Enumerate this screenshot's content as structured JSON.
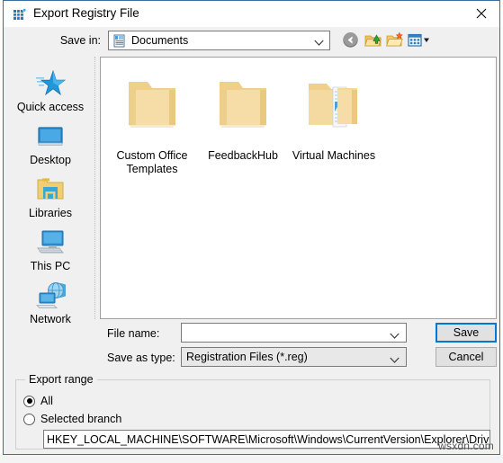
{
  "window": {
    "title": "Export Registry File",
    "icon": "registry-editor-icon",
    "close_label": "✕"
  },
  "toolbar": {
    "save_in_label": "Save in:",
    "current_folder": "Documents",
    "folder_icon": "documents-icon",
    "buttons": [
      {
        "name": "back-button",
        "icon": "back-arrow-icon"
      },
      {
        "name": "up-one-level-button",
        "icon": "up-folder-icon"
      },
      {
        "name": "new-folder-button",
        "icon": "new-folder-icon"
      },
      {
        "name": "views-button",
        "icon": "views-grid-icon"
      }
    ]
  },
  "places_bar": {
    "items": [
      {
        "label": "Quick access",
        "icon": "quick-access-star-icon"
      },
      {
        "label": "Desktop",
        "icon": "desktop-monitor-icon"
      },
      {
        "label": "Libraries",
        "icon": "libraries-folder-icon"
      },
      {
        "label": "This PC",
        "icon": "this-pc-icon"
      },
      {
        "label": "Network",
        "icon": "network-globe-icon"
      }
    ]
  },
  "file_list": {
    "items": [
      {
        "name": "Custom Office Templates",
        "icon": "folder-icon"
      },
      {
        "name": "FeedbackHub",
        "icon": "folder-icon"
      },
      {
        "name": "Virtual Machines",
        "icon": "folder-with-documents-icon"
      }
    ]
  },
  "form": {
    "file_name_label": "File name:",
    "file_name_value": "",
    "save_as_type_label": "Save as type:",
    "save_as_type_value": "Registration Files (*.reg)"
  },
  "buttons": {
    "save_label": "Save",
    "cancel_label": "Cancel",
    "focus_color": "#0078d7"
  },
  "export_range": {
    "legend": "Export range",
    "options": [
      {
        "label": "All",
        "selected": true
      },
      {
        "label": "Selected branch",
        "selected": false
      }
    ],
    "branch_path": "HKEY_LOCAL_MACHINE\\SOFTWARE\\Microsoft\\Windows\\CurrentVersion\\Explorer\\DriveIcons\\C\\D"
  },
  "watermark": "wsxdn.com"
}
